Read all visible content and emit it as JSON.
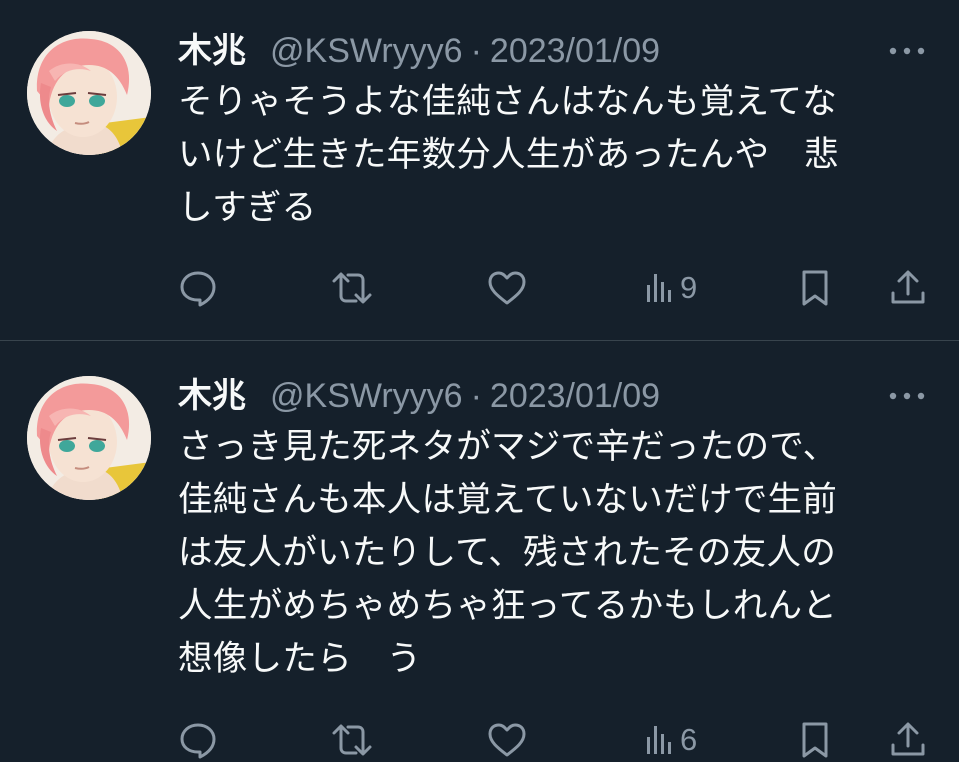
{
  "colors": {
    "background": "#15202b",
    "text_primary": "#f7f9f9",
    "text_secondary": "#8b98a5",
    "divider": "#38444d"
  },
  "tweets": [
    {
      "display_name": "木兆",
      "handle": "@KSWryyy6",
      "separator": "·",
      "date": "2023/01/09",
      "text": "そりゃそうよな佳純さんはなんも覚えてな\nいけど生きた年数分人生があったんや　悲\nしすぎる",
      "views": "9",
      "icons": [
        "more-icon",
        "reply-icon",
        "retweet-icon",
        "like-icon",
        "views-icon",
        "bookmark-icon",
        "share-icon"
      ]
    },
    {
      "display_name": "木兆",
      "handle": "@KSWryyy6",
      "separator": "·",
      "date": "2023/01/09",
      "text": "さっき見た死ネタがマジで辛だったので、\n佳純さんも本人は覚えていないだけで生前\nは友人がいたりして、残されたその友人の\n人生がめちゃめちゃ狂ってるかもしれんと\n想像したら　う",
      "views": "6",
      "icons": [
        "more-icon",
        "reply-icon",
        "retweet-icon",
        "like-icon",
        "views-icon",
        "bookmark-icon",
        "share-icon"
      ]
    }
  ]
}
